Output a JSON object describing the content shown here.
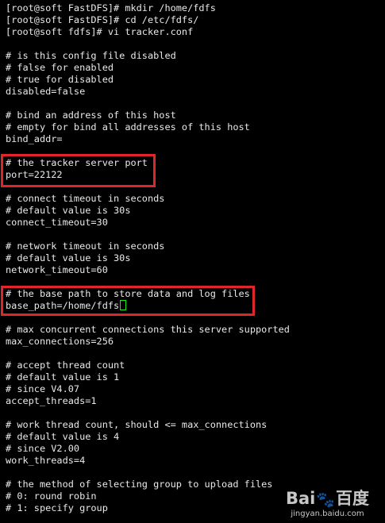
{
  "terminal": {
    "lines": [
      "[root@soft FastDFS]# mkdir /home/fdfs",
      "[root@soft FastDFS]# cd /etc/fdfs/",
      "[root@soft fdfs]# vi tracker.conf",
      "",
      "# is this config file disabled",
      "# false for enabled",
      "# true for disabled",
      "disabled=false",
      "",
      "# bind an address of this host",
      "# empty for bind all addresses of this host",
      "bind_addr=",
      "",
      "# the tracker server port",
      "port=22122",
      "",
      "# connect timeout in seconds",
      "# default value is 30s",
      "connect_timeout=30",
      "",
      "# network timeout in seconds",
      "# default value is 30s",
      "network_timeout=60",
      "",
      "# the base path to store data and log files",
      "base_path=/home/fdfs",
      "",
      "# max concurrent connections this server supported",
      "max_connections=256",
      "",
      "# accept thread count",
      "# default value is 1",
      "# since V4.07",
      "accept_threads=1",
      "",
      "# work thread count, should <= max_connections",
      "# default value is 4",
      "# since V2.00",
      "work_threads=4",
      "",
      "# the method of selecting group to upload files",
      "# 0: round robin",
      "# 1: specify group"
    ]
  },
  "watermark": {
    "logo_left": "Bai",
    "logo_right": "百度",
    "subtitle": "jingyan.baidu.com"
  },
  "colors": {
    "background": "#000000",
    "text": "#e9e9e9",
    "highlight_box": "#e0252b",
    "cursor": "#19e619"
  }
}
